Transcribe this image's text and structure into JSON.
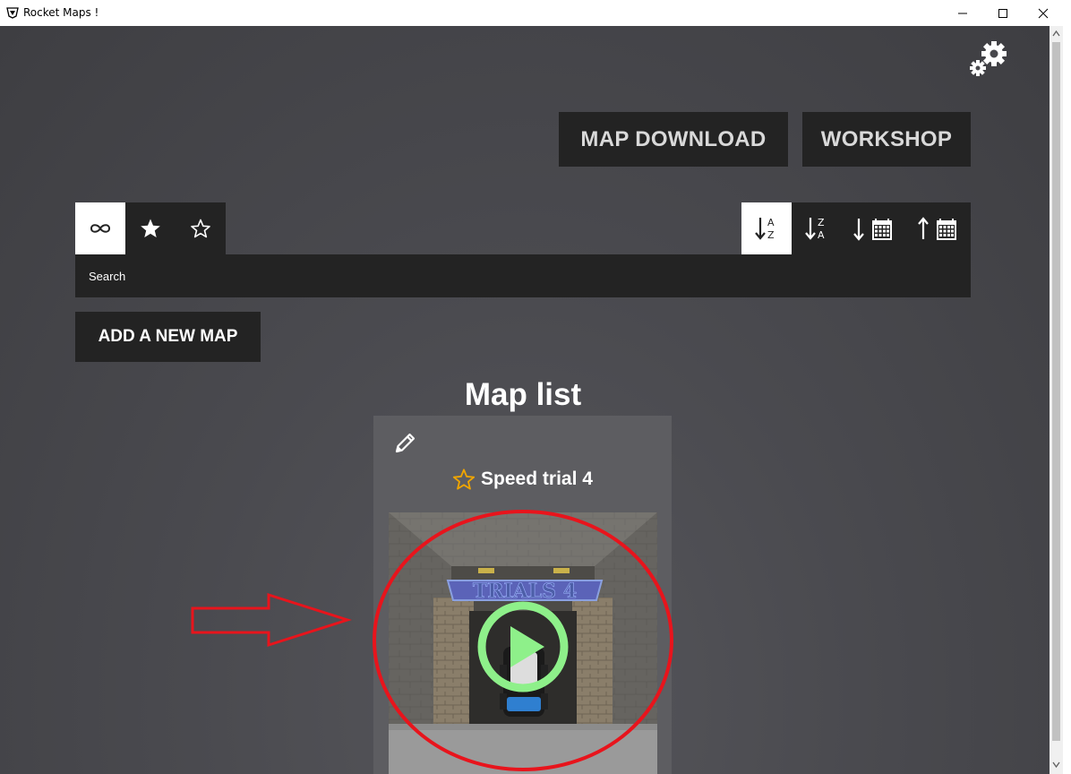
{
  "window": {
    "title": "Rocket Maps !",
    "icon": "rocket-league-icon",
    "controls": [
      "minimize",
      "maximize",
      "close"
    ]
  },
  "header": {
    "settings_icon": "gears-icon",
    "map_download_label": "MAP DOWNLOAD",
    "workshop_label": "WORKSHOP"
  },
  "filters": [
    {
      "icon": "infinity-icon",
      "meaning": "all",
      "active": true
    },
    {
      "icon": "star-filled-icon",
      "meaning": "favorites",
      "active": false
    },
    {
      "icon": "star-outline-icon",
      "meaning": "non-favorites",
      "active": false
    }
  ],
  "sort": [
    {
      "icon": "sort-alpha-asc-icon",
      "glyph_top": "A",
      "glyph_bottom": "Z",
      "active": true
    },
    {
      "icon": "sort-alpha-desc-icon",
      "glyph_top": "Z",
      "glyph_bottom": "A",
      "active": false
    },
    {
      "icon": "sort-date-desc-icon",
      "active": false
    },
    {
      "icon": "sort-date-asc-icon",
      "active": false
    }
  ],
  "search": {
    "placeholder": "Search"
  },
  "add_map_label": "ADD A NEW MAP",
  "list_title": "Map list",
  "maps": [
    {
      "name": "Speed trial 4",
      "favorite": false,
      "thumbnail_banner": "TRIALS 4",
      "play_icon": "play-circle-icon",
      "edit_icon": "pencil-icon"
    }
  ],
  "colors": {
    "background": "#47474c",
    "button_bg": "#232323",
    "card_bg": "#5d5d61",
    "star_accent": "#f0a500",
    "play_green": "#8ef08a",
    "annotation_red": "#e8141c"
  }
}
